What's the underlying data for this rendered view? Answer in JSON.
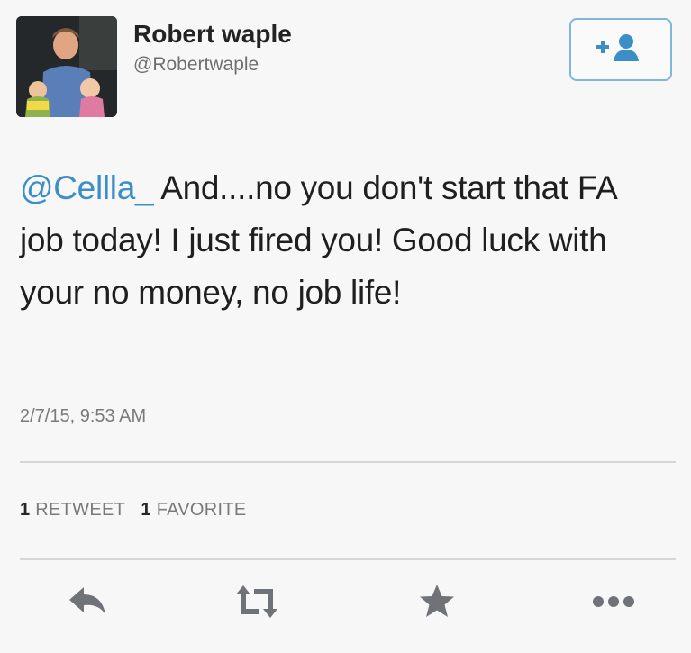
{
  "user": {
    "name": "Robert waple",
    "handle": "@Robertwaple"
  },
  "tweet": {
    "mention": "@Cellla_",
    "body": " And....no you don't start that FA job today!  I just fired you! Good luck with your no money, no job life!",
    "timestamp": "2/7/15, 9:53 AM"
  },
  "stats": {
    "retweet_count": "1",
    "retweet_label": "RETWEET",
    "favorite_count": "1",
    "favorite_label": "FAVORITE"
  },
  "colors": {
    "link": "#3b8fc6",
    "follow_border": "#7fb6de",
    "icon_gray": "#6f7378"
  },
  "icons": [
    "follow-icon",
    "reply-icon",
    "retweet-icon",
    "favorite-icon",
    "more-icon"
  ]
}
